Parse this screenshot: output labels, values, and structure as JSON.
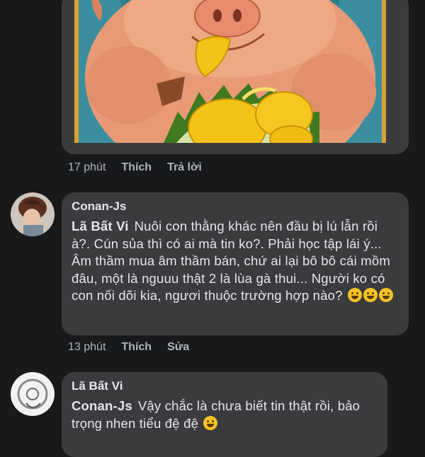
{
  "comments": [
    {
      "time": "17 phút",
      "like_label": "Thích",
      "action_label": "Trả lời"
    },
    {
      "author": "Conan-Js",
      "mention": "Lã Bất Vi",
      "text": "Nuôi con thằng khác nên đầu bị lú lẫn rồi à?. Cún sủa thì có ai mà tin ko?. Phải học tập lái ý... Âm thầm mua âm thầm bán, chứ ai lại bô bô cái mồm đâu, một là nguuu thật 2 là lùa gà thui... Người ko có con nối dõi kia, ngươi thuộc trường hợp nào?",
      "emojis": [
        "rofl-emoji",
        "rofl-emoji",
        "rofl-emoji"
      ],
      "time": "13 phút",
      "like_label": "Thích",
      "action_label": "Sửa"
    },
    {
      "author": "Lã Bất Vi",
      "mention": "Conan-Js",
      "text": "Vậy chắc là chưa biết tin thật rồi, bảo trọng nhen tiểu đệ đệ"
    }
  ],
  "colors": {
    "background": "#18191a",
    "bubble": "#3a3b3c",
    "text": "#e4e6eb",
    "meta": "#b0b3b8"
  }
}
